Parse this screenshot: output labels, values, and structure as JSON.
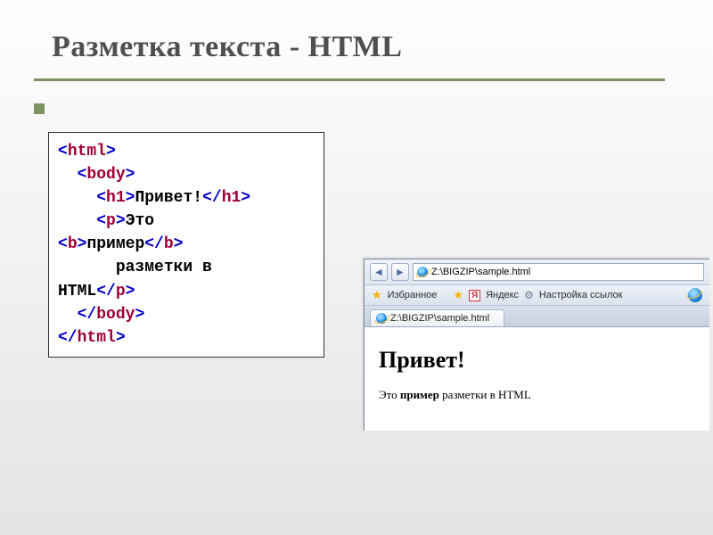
{
  "slide": {
    "title": "Разметка текста - HTML"
  },
  "code": {
    "line1_open": "html",
    "line2_open": "body",
    "line3_open": "h1",
    "line3_text": "Привет!",
    "line3_close": "h1",
    "line4_open": "p",
    "line4_text": "Это",
    "line5_bopen": "b",
    "line5_btext": "пример",
    "line5_bclose": "b",
    "line6_text": "разметки в",
    "line7_text": "HTML",
    "line7_close": "p",
    "line8_close": "body",
    "line9_close": "html"
  },
  "browser": {
    "address": "Z:\\BIGZIP\\sample.html",
    "toolbar": {
      "favorites": "Избранное",
      "ya": "Я",
      "yandex": "Яндекс",
      "settings": "Настройка ссылок"
    },
    "tab": "Z:\\BIGZIP\\sample.html",
    "content": {
      "heading": "Привет!",
      "p_before": "Это ",
      "p_bold": "пример",
      "p_after": " разметки в HTML"
    }
  }
}
